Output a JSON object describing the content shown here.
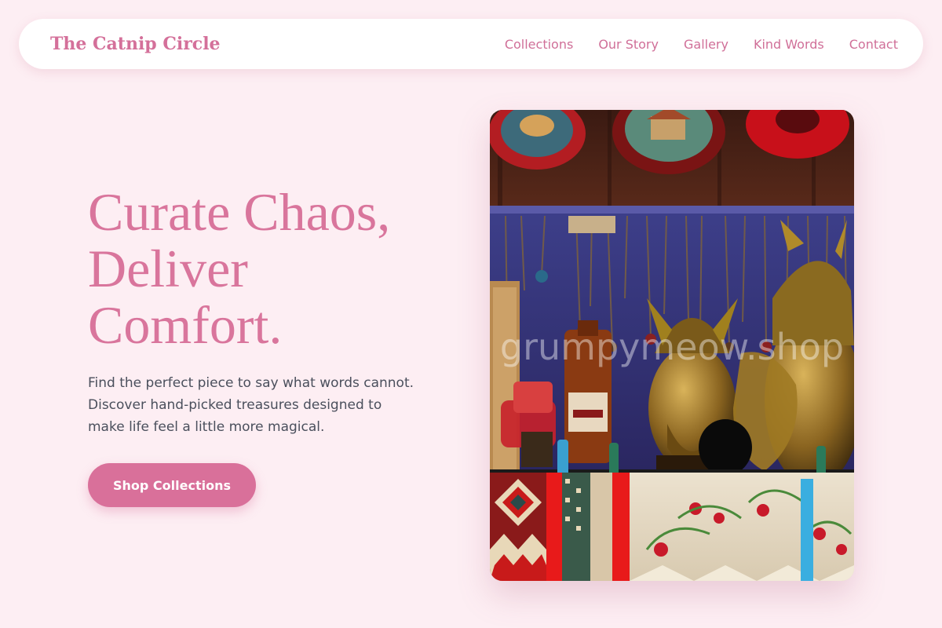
{
  "brand": {
    "name": "The Catnip Circle"
  },
  "nav": {
    "items": [
      {
        "label": "Collections"
      },
      {
        "label": "Our Story"
      },
      {
        "label": "Gallery"
      },
      {
        "label": "Kind Words"
      },
      {
        "label": "Contact"
      }
    ]
  },
  "hero": {
    "title_lines": [
      "Curate Chaos,",
      "Deliver",
      "Comfort."
    ],
    "subtitle_lines": [
      "Find the perfect piece to say what words cannot.",
      "Discover hand-picked treasures designed to",
      "make life feel a little more magical."
    ],
    "cta_label": "Shop Collections"
  },
  "image": {
    "watermark": "grumpymeow.shop"
  },
  "colors": {
    "background": "#fdeef3",
    "accent": "#d9709a",
    "text": "#4a4f5c"
  }
}
